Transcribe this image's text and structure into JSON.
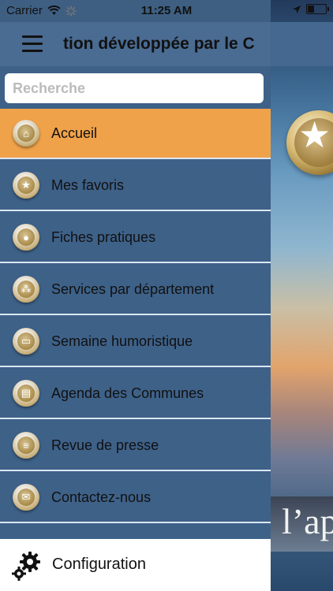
{
  "status_bar": {
    "carrier": "Carrier",
    "time": "11:25 AM"
  },
  "header": {
    "title": "tion développée par le C",
    "menu_icon": "hamburger-icon"
  },
  "search": {
    "placeholder": "Recherche",
    "value": ""
  },
  "menu": {
    "items": [
      {
        "label": "Accueil",
        "icon": "home-icon",
        "active": true
      },
      {
        "label": "Mes favoris",
        "icon": "star-icon",
        "active": false
      },
      {
        "label": "Fiches pratiques",
        "icon": "person-icon",
        "active": false
      },
      {
        "label": "Services par département",
        "icon": "people-icon",
        "active": false
      },
      {
        "label": "Semaine humoristique",
        "icon": "id-card-icon",
        "active": false
      },
      {
        "label": "Agenda des Communes",
        "icon": "book-icon",
        "active": false
      },
      {
        "label": "Revue de presse",
        "icon": "document-icon",
        "active": false
      },
      {
        "label": "Contactez-nous",
        "icon": "envelope-icon",
        "active": false
      }
    ]
  },
  "footer": {
    "config_label": "Configuration",
    "icon": "gear-icon"
  },
  "background_app": {
    "banner_text": "l’ap"
  },
  "colors": {
    "active_item": "#f0a24a",
    "menu_background": "#3e6188",
    "header_background": "#4a6b92"
  }
}
